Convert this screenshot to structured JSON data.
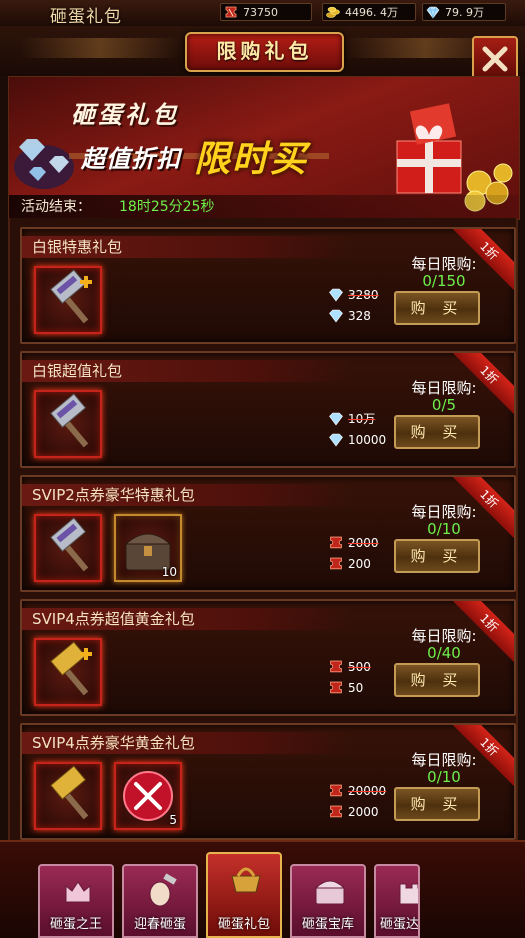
{
  "app_title": "砸蛋礼包",
  "resources": {
    "coupon": "73750",
    "gold": "4496. 4万",
    "diamond": "79. 9万"
  },
  "header": {
    "title": "限购礼包",
    "close_icon": "close-icon"
  },
  "banner": {
    "title_1": "砸蛋礼包",
    "title_2": "超值折扣",
    "title_3": "限时买",
    "countdown_label": "活动结束：",
    "countdown_value": "18时25分25秒"
  },
  "gifts": [
    {
      "name": "白银特惠礼包",
      "currency": "diamond",
      "old_price": "3280",
      "price": "328",
      "daily_label": "每日限购:",
      "daily_count": "0/150",
      "buy_label": "购 买",
      "discount": "1折",
      "items": [
        {
          "icon": "silver-hammer-plus-icon",
          "qty": ""
        }
      ]
    },
    {
      "name": "白银超值礼包",
      "currency": "diamond",
      "old_price": "10万",
      "price": "10000",
      "daily_label": "每日限购:",
      "daily_count": "0/5",
      "buy_label": "购 买",
      "discount": "1折",
      "items": [
        {
          "icon": "silver-hammer-icon",
          "qty": ""
        }
      ]
    },
    {
      "name": "SVIP2点券豪华特惠礼包",
      "currency": "coupon",
      "old_price": "2000",
      "price": "200",
      "daily_label": "每日限购:",
      "daily_count": "0/10",
      "buy_label": "购 买",
      "discount": "1折",
      "items": [
        {
          "icon": "silver-hammer-icon",
          "qty": ""
        },
        {
          "icon": "treasure-chest-icon",
          "qty": "10"
        }
      ]
    },
    {
      "name": "SVIP4点券超值黄金礼包",
      "currency": "coupon",
      "old_price": "500",
      "price": "50",
      "daily_label": "每日限购:",
      "daily_count": "0/40",
      "buy_label": "购 买",
      "discount": "1折",
      "items": [
        {
          "icon": "gold-hammer-plus-icon",
          "qty": ""
        }
      ]
    },
    {
      "name": "SVIP4点券豪华黄金礼包",
      "currency": "coupon",
      "old_price": "20000",
      "price": "2000",
      "daily_label": "每日限购:",
      "daily_count": "0/10",
      "buy_label": "购 买",
      "discount": "1折",
      "items": [
        {
          "icon": "gold-hammer-icon",
          "qty": ""
        },
        {
          "icon": "crossed-swords-orb-icon",
          "qty": "5"
        }
      ]
    }
  ],
  "nav": [
    {
      "label": "砸蛋之王",
      "icon": "crown-castle-icon",
      "active": false
    },
    {
      "label": "迎春砸蛋",
      "icon": "hammer-egg-icon",
      "active": false
    },
    {
      "label": "砸蛋礼包",
      "icon": "gift-basket-icon",
      "active": true
    },
    {
      "label": "砸蛋宝库",
      "icon": "treasure-chest-icon",
      "active": false
    },
    {
      "label": "砸蛋达",
      "icon": "castle-icon",
      "active": false
    }
  ],
  "colors": {
    "accent_gold": "#d9a14b",
    "countdown_green": "#6df04a",
    "ribbon_red": "#d52419"
  }
}
